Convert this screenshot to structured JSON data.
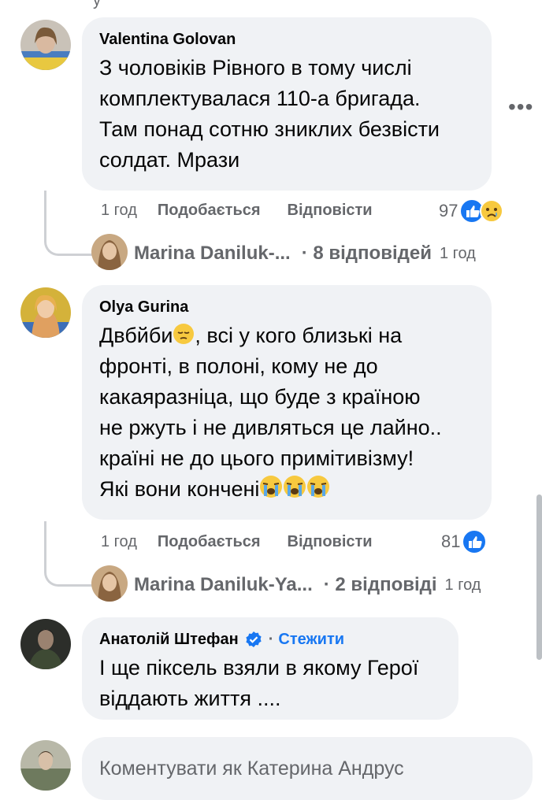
{
  "top_fragment": "у",
  "comments": [
    {
      "author": "Valentina Golovan",
      "text": "З чоловіків Рівного в тому числі\nкомплектувалася 110-а бригада.\nТам понад сотню зниклих безвісти\nсолдат. Мрази",
      "time": "1 год",
      "like_label": "Подобається",
      "reply_label": "Відповісти",
      "reaction_count": "97",
      "reactions": [
        "like-icon",
        "sad-icon"
      ],
      "replies": {
        "name": "Marina Daniluk-...",
        "count": "· 8 відповідей",
        "time": "1 год"
      }
    },
    {
      "author": "Olya Gurina",
      "text_parts": [
        "Двбйби",
        "emoji:pensive",
        ", всі у кого близькі на\nфронті, в полоні, кому не до\nкакаяразніца, що буде з країною\nне ржуть і не дивляться це лайно..\nкраїні не до цього примітивізму!\nЯкі вони кончені",
        "emoji:crying",
        "emoji:crying",
        "emoji:crying"
      ],
      "text_a": "Двбйби",
      "text_b": ", всі у кого близькі на\nфронті, в полоні, кому не до\nкакаяразніца, що буде з країною\nне ржуть і не дивляться це лайно..\nкраїні не до цього примітивізму!\nЯкі вони кончені",
      "time": "1 год",
      "like_label": "Подобається",
      "reply_label": "Відповісти",
      "reaction_count": "81",
      "reactions": [
        "like-icon"
      ],
      "replies": {
        "name": "Marina Daniluk-Ya...",
        "count": "· 2 відповіді",
        "time": "1 год"
      }
    },
    {
      "author": "Анатолій Штефан",
      "follow_label": "Стежити",
      "verified": true,
      "text": "І ще піксель взяли в якому Герої\nвіддають життя ...."
    }
  ],
  "composer": {
    "placeholder": "Коментувати як Катерина Андрус"
  },
  "colors": {
    "bubble": "#f0f2f5",
    "secondary": "#65676b",
    "link": "#1877f2",
    "like": "#1877f2"
  }
}
